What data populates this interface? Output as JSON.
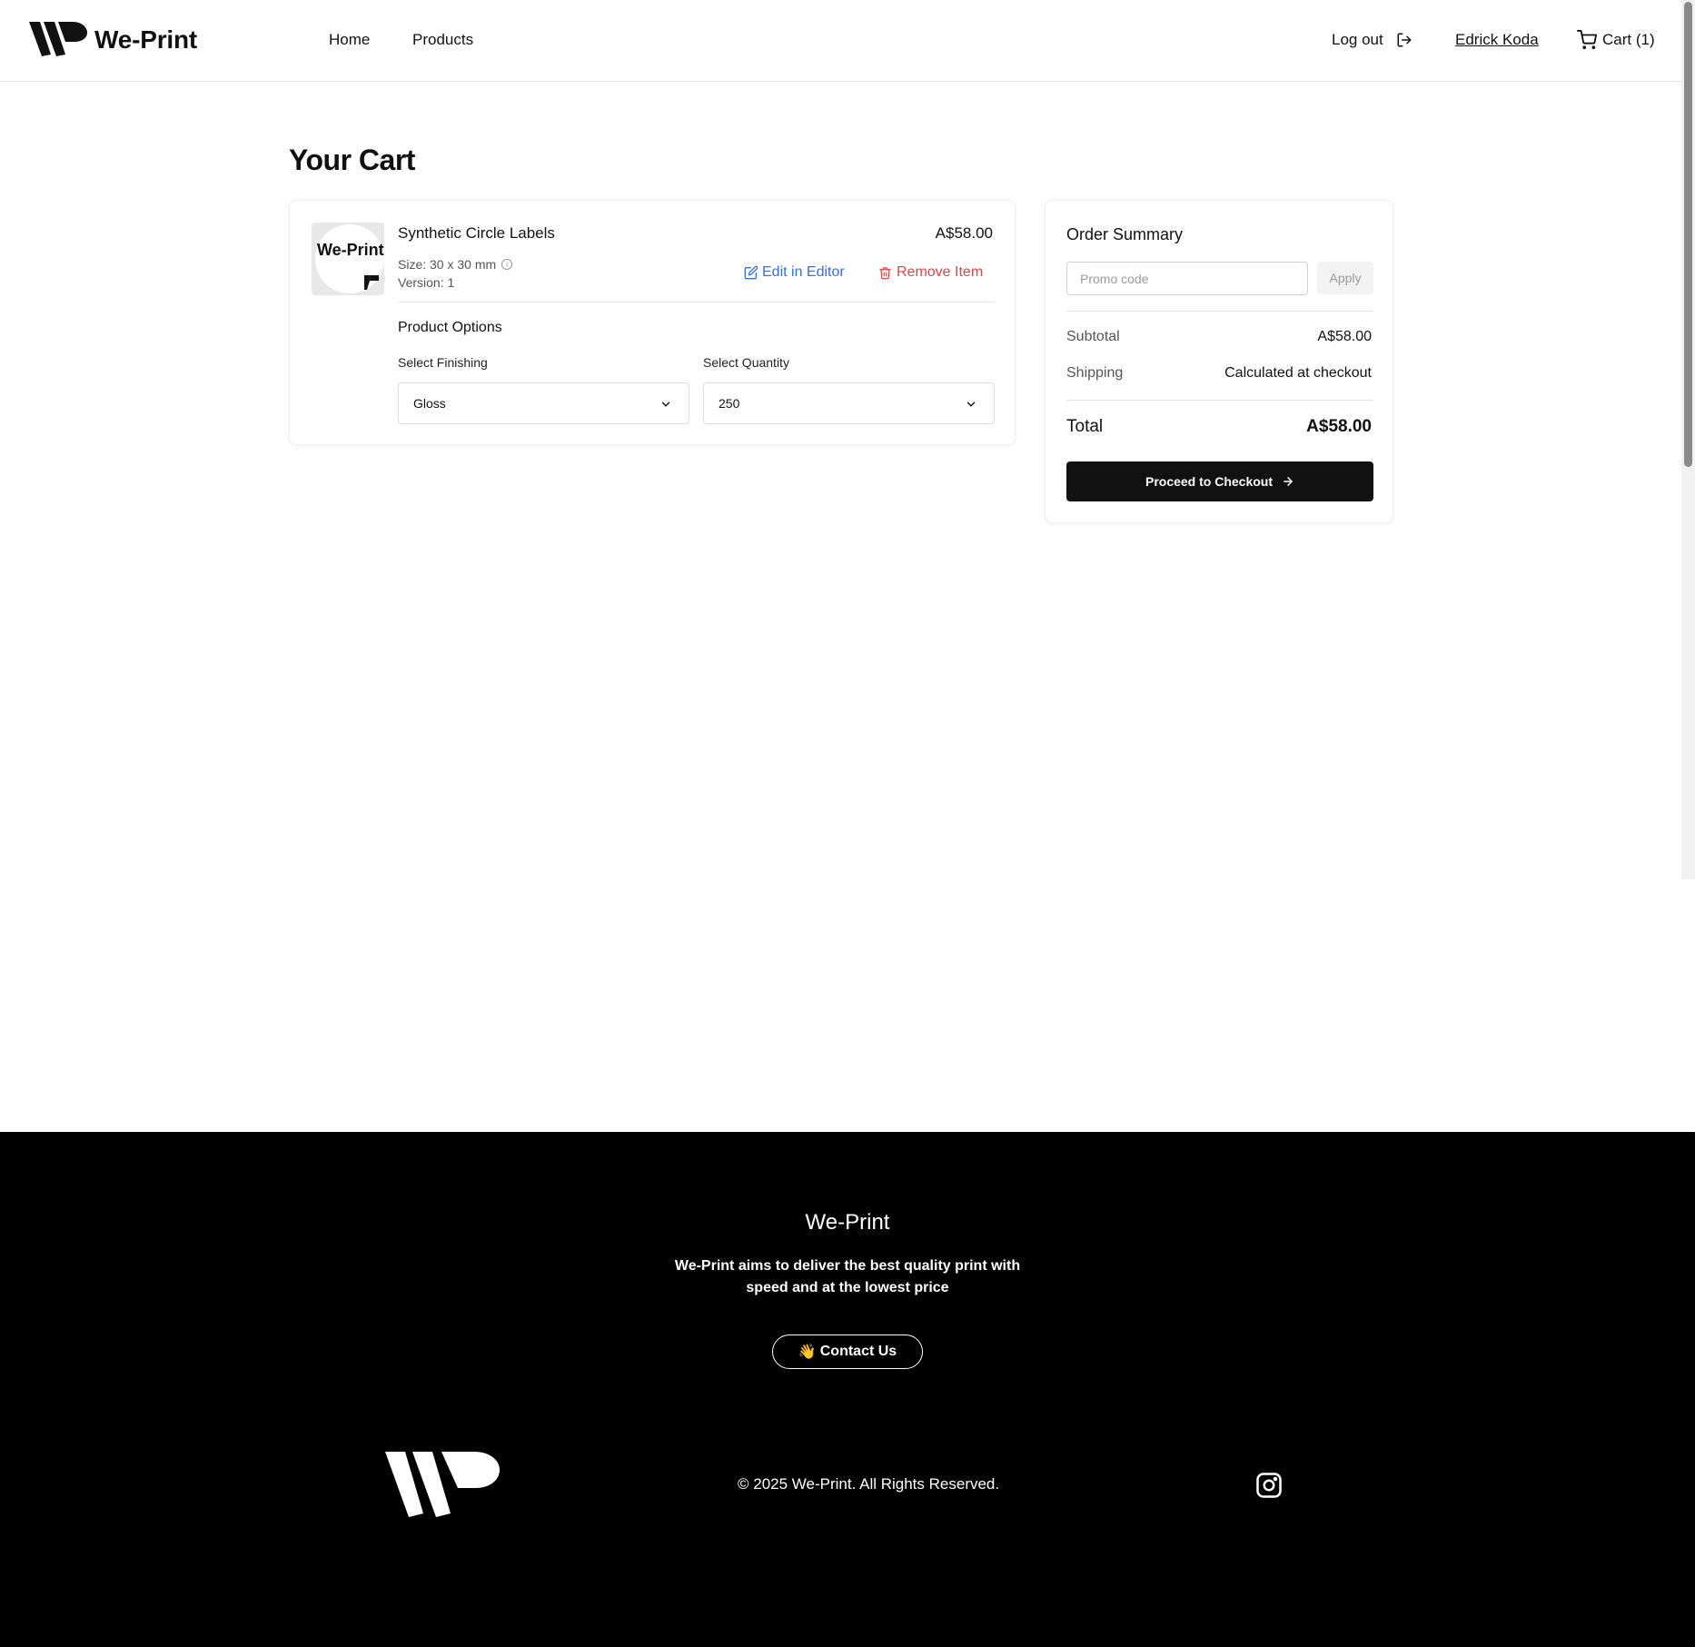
{
  "header": {
    "brand": "We-Print",
    "nav": {
      "home": "Home",
      "products": "Products"
    },
    "logout": "Log out",
    "user_name": "Edrick Koda",
    "cart": "Cart (1)"
  },
  "page_title": "Your Cart",
  "cart_item": {
    "thumbnail_text": "We-Print",
    "name": "Synthetic Circle Labels",
    "price": "A$58.00",
    "size": "Size: 30 x 30 mm",
    "version": "Version: 1",
    "edit_label": "Edit in Editor",
    "remove_label": "Remove Item",
    "options_title": "Product Options",
    "finishing_label": "Select Finishing",
    "finishing_value": "Gloss",
    "quantity_label": "Select Quantity",
    "quantity_value": "250"
  },
  "summary": {
    "title": "Order Summary",
    "promo_placeholder": "Promo code",
    "apply_label": "Apply",
    "subtotal_label": "Subtotal",
    "subtotal_value": "A$58.00",
    "shipping_label": "Shipping",
    "shipping_value": "Calculated at checkout",
    "total_label": "Total",
    "total_value": "A$58.00",
    "checkout_label": "Proceed to Checkout"
  },
  "footer": {
    "brand": "We-Print",
    "tagline": "We-Print aims to deliver the best quality print with speed and at the lowest price",
    "contact_emoji": "👋",
    "contact_label": "Contact Us",
    "copyright": "© 2025 We-Print. All Rights Reserved."
  },
  "icons": {
    "logo": "we-print-logo-icon",
    "logout": "log-out-icon",
    "cart": "shopping-cart-icon",
    "info": "info-icon",
    "edit": "edit-icon",
    "trash": "trash-icon",
    "chevron": "chevron-down-icon",
    "arrow": "arrow-right-icon",
    "instagram": "instagram-icon"
  },
  "colors": {
    "edit_link": "#3b6fd4",
    "remove_link": "#e04545",
    "primary_button": "#111111",
    "footer_bg": "#000000"
  }
}
